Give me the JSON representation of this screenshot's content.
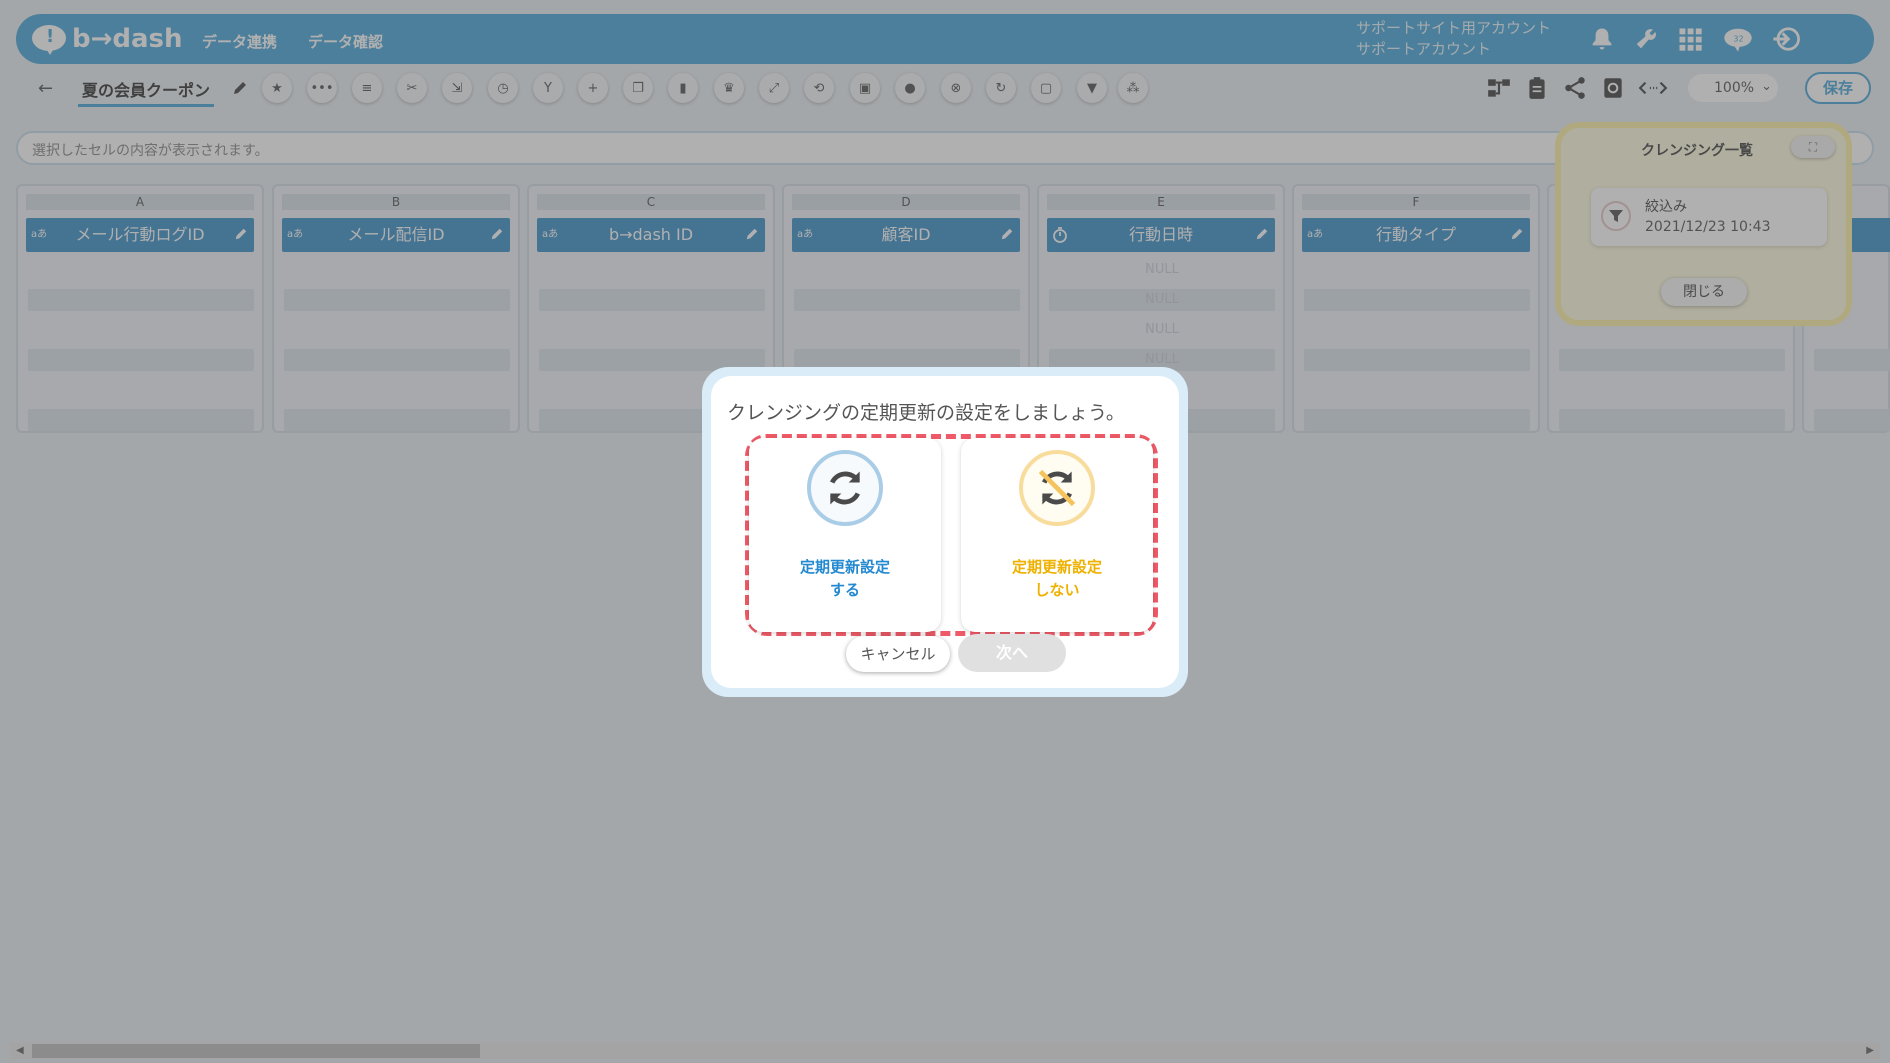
{
  "app": {
    "name": "b→dash"
  },
  "header": {
    "nav": [
      "データ連携",
      "データ確認"
    ],
    "account_line1": "サポートサイト用アカウント",
    "account_line2": "サポートアカウント",
    "icons": [
      "bell-icon",
      "wrench-icon",
      "grid-icon",
      "cloud-badge-icon",
      "logout-icon"
    ]
  },
  "toolbar": {
    "title": "夏の会員クーポン",
    "zoom": "100%",
    "save_label": "保存",
    "tool_icons": [
      "star-icon",
      "dots-icon",
      "list-icon",
      "scissors-icon",
      "merge-icon",
      "timer-icon",
      "fork-icon",
      "plus-icon",
      "copy-icon",
      "trash-icon",
      "crown-icon",
      "expand-icon",
      "repeat-icon",
      "lock-icon",
      "drop-icon",
      "close-circle-icon",
      "refresh-icon",
      "box-icon",
      "filter-icon",
      "group-icon"
    ],
    "right_icons": [
      "flow-icon",
      "clipboard-icon",
      "share-icon",
      "history-icon",
      "code-icon"
    ]
  },
  "cellbar": {
    "placeholder": "選択したセルの内容が表示されます。"
  },
  "columns": [
    {
      "letter": "A",
      "name": "メール行動ログID",
      "type": "aあ"
    },
    {
      "letter": "B",
      "name": "メール配信ID",
      "type": "aあ"
    },
    {
      "letter": "C",
      "name": "b→dash ID",
      "type": "aあ"
    },
    {
      "letter": "D",
      "name": "顧客ID",
      "type": "aあ"
    },
    {
      "letter": "E",
      "name": "行動日時",
      "type": "timer"
    },
    {
      "letter": "F",
      "name": "行動タイプ",
      "type": "aあ"
    }
  ],
  "null_label": "NULL",
  "panel": {
    "title": "クレンジング一覧",
    "filter_name": "絞込み",
    "filter_date": "2021/12/23 10:43",
    "close_label": "閉じる"
  },
  "modal": {
    "title": "クレンジングの定期更新の設定をしましょう。",
    "option_yes_line1": "定期更新設定",
    "option_yes_line2": "する",
    "option_no_line1": "定期更新設定",
    "option_no_line2": "しない",
    "cancel_label": "キャンセル",
    "next_label": "次へ"
  },
  "colors": {
    "brand": "#4aa7d9",
    "highlight_dash": "#f05a68",
    "yes": "#2389d0",
    "no": "#efb100"
  }
}
